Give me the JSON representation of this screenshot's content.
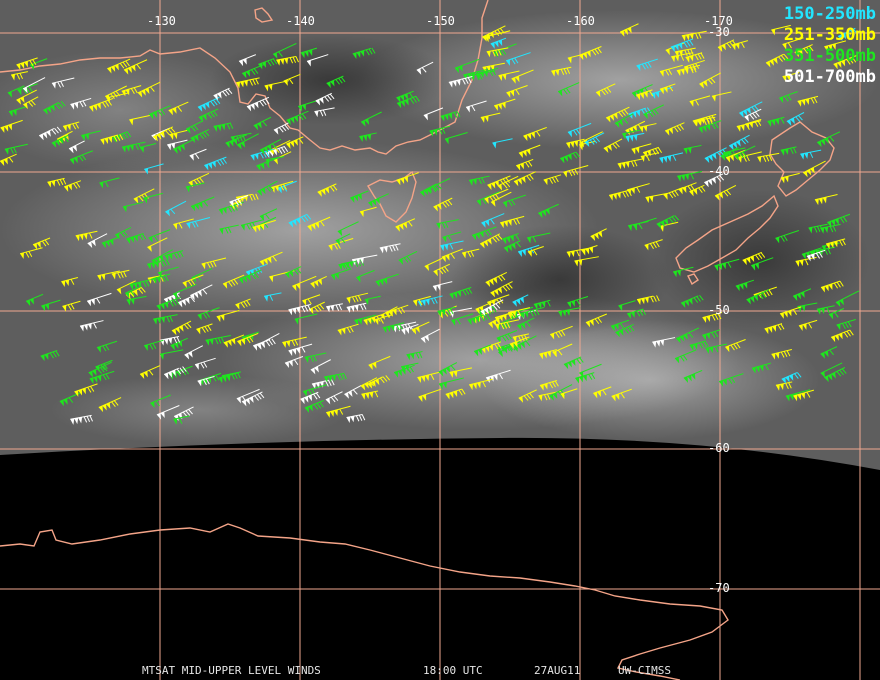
{
  "legend": [
    {
      "label": "150-250mb",
      "color": "#22e6ff"
    },
    {
      "label": "251-350mb",
      "color": "#ffff00"
    },
    {
      "label": "351-500mb",
      "color": "#1ee61e"
    },
    {
      "label": "501-700mb",
      "color": "#ffffff"
    }
  ],
  "lon_labels": [
    "-130",
    "-140",
    "-150",
    "-160",
    "-170"
  ],
  "lat_labels": [
    "-30",
    "-40",
    "-50",
    "-60",
    "-70"
  ],
  "footer": {
    "product": "MTSAT MID-UPPER LEVEL WINDS",
    "time": "18:00 UTC",
    "date": "27AUG11",
    "source": "UW-CIMSS"
  },
  "colors": {
    "grid": "#f0a890",
    "coast": "#f4a488",
    "background": "#000000"
  }
}
